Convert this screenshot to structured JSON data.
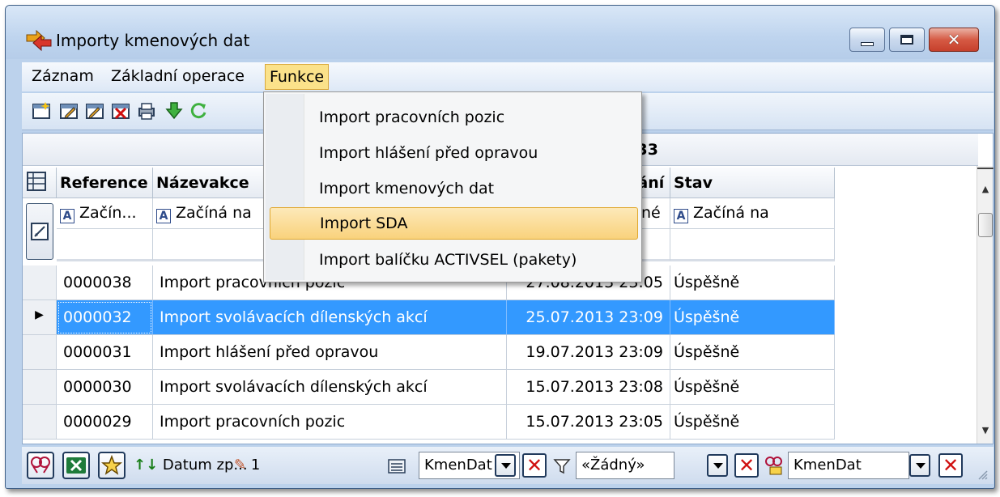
{
  "window": {
    "title": "Importy kmenových dat",
    "icon": "import-arrows-icon"
  },
  "menu": {
    "items": [
      "Záznam",
      "Základní operace",
      "Funkce"
    ],
    "open": "Funkce"
  },
  "dropdown": {
    "items": [
      "Import pracovních pozic",
      "Import hlášení před opravou",
      "Import kmenových dat",
      "Import SDA",
      "Import balíčku ACTIVSEL (pakety)"
    ],
    "highlighted": "Import SDA"
  },
  "grid": {
    "group_text": "/ 33",
    "headers": {
      "reference": "Reference",
      "nazev": "Názevakce",
      "datum": "vání",
      "stav": "Stav"
    },
    "filters": {
      "reference": "Začín...",
      "nazev": "Začíná na",
      "datum": "ejné",
      "stav": "Začíná na"
    },
    "rows": [
      {
        "reference": "0000038",
        "nazev": "Import pracovních pozic",
        "datum": "27.08.2013 23:05",
        "stav": "Úspěšně",
        "selected": false
      },
      {
        "reference": "0000032",
        "nazev": "Import svolávacích dílenských akcí",
        "datum": "25.07.2013 23:09",
        "stav": "Úspěšně",
        "selected": true
      },
      {
        "reference": "0000031",
        "nazev": "Import hlášení před opravou",
        "datum": "19.07.2013 23:09",
        "stav": "Úspěšně",
        "selected": false
      },
      {
        "reference": "0000030",
        "nazev": "Import svolávacích dílenských akcí",
        "datum": "15.07.2013 23:08",
        "stav": "Úspěšně",
        "selected": false
      },
      {
        "reference": "0000029",
        "nazev": "Import pracovních pozic",
        "datum": "15.07.2013 23:05",
        "stav": "Úspěšně",
        "selected": false
      }
    ]
  },
  "statusbar": {
    "sort_label": "Datum zp...",
    "count": "1",
    "combo1": "KmenDat",
    "combo2": "«Žádný»",
    "combo3": "KmenDat"
  },
  "colors": {
    "selection": "#3399ff",
    "menu_highlight": "#fbe28a",
    "window_frame": "#bcd2ec"
  }
}
